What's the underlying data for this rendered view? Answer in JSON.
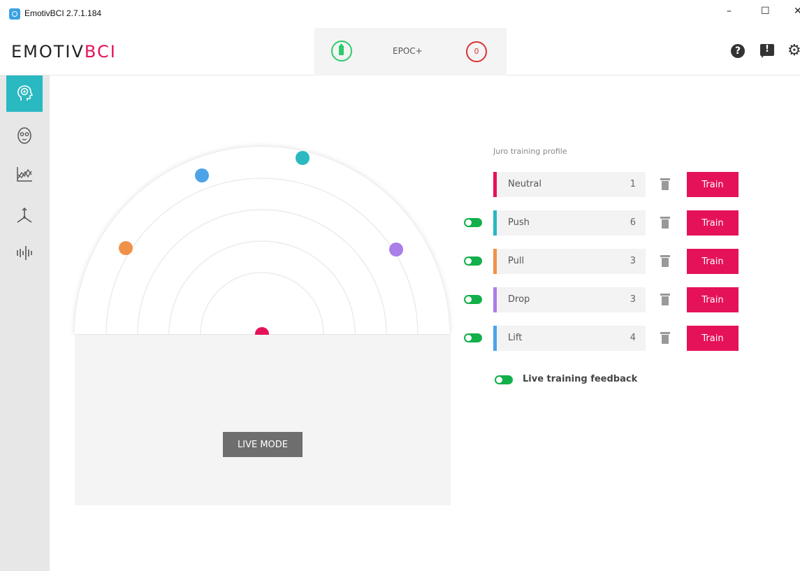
{
  "window": {
    "title": "EmotivBCI 2.7.1.184",
    "min": "–",
    "max": "☐",
    "close": "✕"
  },
  "header": {
    "logo_main": "EMOTIV",
    "logo_accent": "BCI",
    "device_name": "EPOC+",
    "contact_count": "0",
    "help_glyph": "?",
    "settings_glyph": "⚙"
  },
  "sidebar": {
    "items": [
      {
        "icon": "mental-commands-icon",
        "active": true
      },
      {
        "icon": "facial-expressions-icon",
        "active": false
      },
      {
        "icon": "performance-metrics-icon",
        "active": false
      },
      {
        "icon": "motion-sensors-icon",
        "active": false
      },
      {
        "icon": "raw-eeg-icon",
        "active": false
      }
    ]
  },
  "colors": {
    "accent": "#e5125a",
    "teal": "#2ab8c1",
    "green": "#12b04a",
    "neutral": "#e5125a",
    "push": "#2ab8c1",
    "pull": "#f0914a",
    "drop": "#a97ee8",
    "lift": "#4da3e8"
  },
  "live_mode_label": "LIVE MODE",
  "profile": {
    "label": "Juro training profile",
    "commands": [
      {
        "name": "Neutral",
        "count": "1",
        "color": "#e5125a",
        "toggle": false,
        "train_label": "Train"
      },
      {
        "name": "Push",
        "count": "6",
        "color": "#2ab8c1",
        "toggle": true,
        "train_label": "Train"
      },
      {
        "name": "Pull",
        "count": "3",
        "color": "#f0914a",
        "toggle": true,
        "train_label": "Train"
      },
      {
        "name": "Drop",
        "count": "3",
        "color": "#a97ee8",
        "toggle": true,
        "train_label": "Train"
      },
      {
        "name": "Lift",
        "count": "4",
        "color": "#4da3e8",
        "toggle": true,
        "train_label": "Train"
      }
    ],
    "live_feedback_label": "Live training feedback"
  }
}
